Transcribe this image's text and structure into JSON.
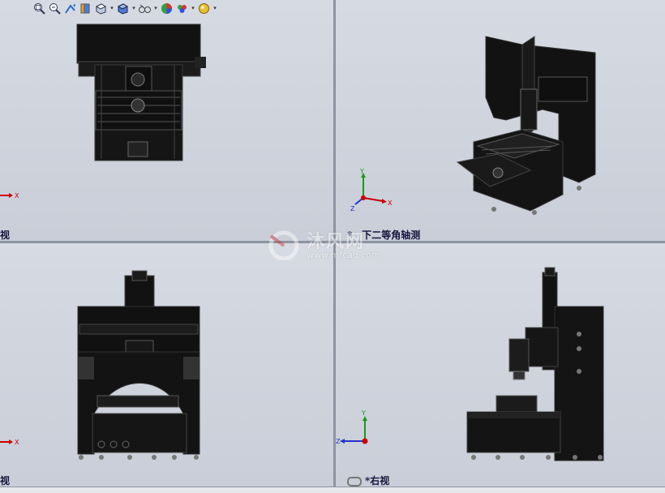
{
  "viewports": {
    "top_left": {
      "label": "视"
    },
    "top_right": {
      "label": "下二等角轴测",
      "prefix": "*"
    },
    "bottom_left": {
      "label": "视"
    },
    "bottom_right": {
      "label": "*右视"
    }
  },
  "triad": {
    "x": "X",
    "y": "Y",
    "z": "Z"
  },
  "watermark": {
    "text": "沐风网",
    "url": "www.mfcad.com"
  },
  "toolbar": {
    "icons": [
      "zoom-to-fit-icon",
      "zoom-to-area-icon",
      "previous-view-icon",
      "section-view-icon",
      "view-orientation-icon",
      "display-style-icon",
      "hide-show-items-icon",
      "edit-appearance-icon",
      "apply-scene-icon",
      "view-settings-icon"
    ]
  },
  "colors": {
    "viewport_bg": "#d0d5de",
    "divider": "#8d94a1",
    "label": "#14143c",
    "model": "#111111"
  }
}
